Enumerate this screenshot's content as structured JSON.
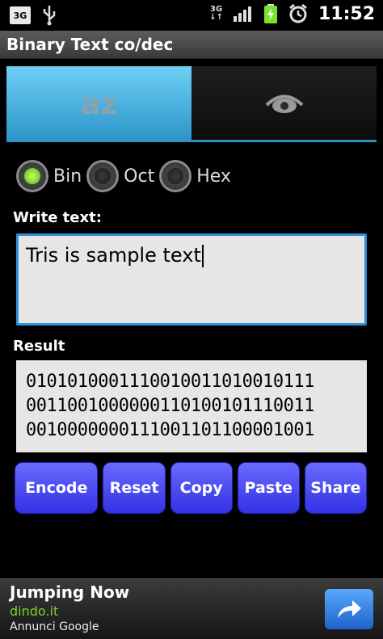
{
  "status_bar": {
    "network_left": "3G",
    "network_right": "3G",
    "time": "11:52",
    "icons": [
      "3g-icon",
      "usb-icon",
      "3g-data-icon",
      "signal-icon",
      "battery-charging-icon",
      "alarm-icon"
    ]
  },
  "app": {
    "title": "Binary Text co/dec"
  },
  "tabs": [
    {
      "label": "az",
      "active": true
    },
    {
      "icon": "eye-icon",
      "active": false
    }
  ],
  "radio": {
    "options": [
      {
        "label": "Bin",
        "selected": true
      },
      {
        "label": "Oct",
        "selected": false
      },
      {
        "label": "Hex",
        "selected": false
      }
    ]
  },
  "input": {
    "label": "Write text:",
    "value": "Tris is sample text"
  },
  "result": {
    "label": "Result",
    "lines": [
      "0101010001110010011010010111",
      "0011001000000110100101110011",
      "0010000000111001101100001001"
    ]
  },
  "buttons": {
    "encode": "Encode",
    "reset": "Reset",
    "copy": "Copy",
    "paste": "Paste",
    "share": "Share"
  },
  "ad": {
    "title": "Jumping Now",
    "domain": "dindo.it",
    "provider": "Annunci Google"
  },
  "colors": {
    "accent_blue": "#2f8fd6",
    "button": "#4a4af0",
    "selected_radio": "#7be32b",
    "ad_domain": "#7ed321"
  }
}
